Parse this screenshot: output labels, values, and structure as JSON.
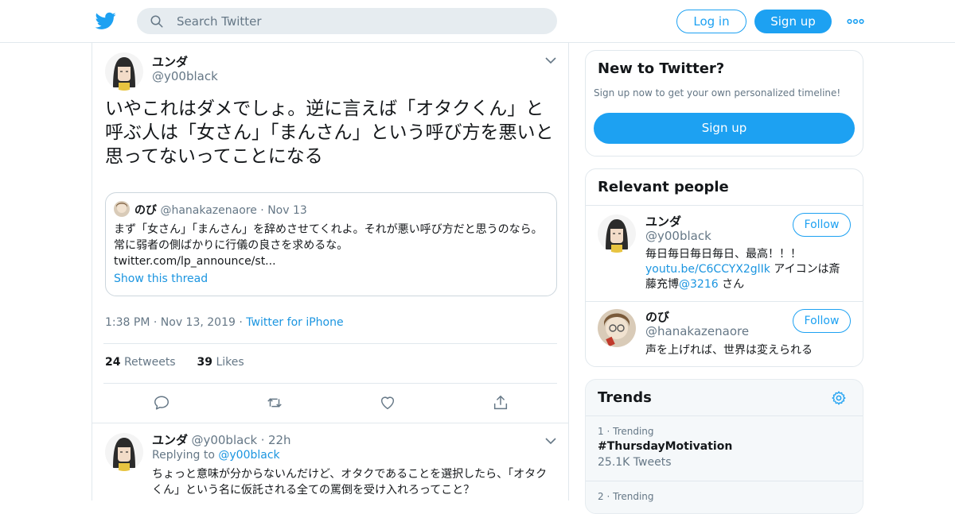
{
  "header": {
    "search_placeholder": "Search Twitter",
    "login_label": "Log in",
    "signup_label": "Sign up"
  },
  "tweet": {
    "display_name": "ユンダ",
    "handle": "@y00black",
    "text": "いやこれはダメでしょ。逆に言えば「オタクくん」と呼ぶ人は「女さん」「まんさん」という呼び方を悪いと思ってないってことになる",
    "quote": {
      "display_name": "のび",
      "handle": "@hanakazenaore",
      "separator": "·",
      "date": "Nov 13",
      "text": "まず「女さん」「まんさん」を辞めさせてくれよ。それが悪い呼び方だと思うのなら。常に弱者の側ばかりに行儀の良さを求めるな。",
      "link": "twitter.com/lp_announce/st...",
      "show_thread": "Show this thread"
    },
    "time": "1:38 PM",
    "date": "Nov 13, 2019",
    "source": "Twitter for iPhone",
    "retweets_count": "24",
    "retweets_label": "Retweets",
    "likes_count": "39",
    "likes_label": "Likes"
  },
  "reply": {
    "display_name": "ユンダ",
    "handle": "@y00black",
    "age": "22h",
    "replying_prefix": "Replying to",
    "replying_to": "@y00black",
    "text": "ちょっと意味が分からないんだけど、オタクであることを選択したら、「オタクくん」という名に仮託される全ての罵倒を受け入れろってこと？"
  },
  "sidebar": {
    "new_to_twitter": {
      "title": "New to Twitter?",
      "subtitle": "Sign up now to get your own personalized timeline!",
      "button": "Sign up"
    },
    "relevant_people": {
      "title": "Relevant people",
      "people": [
        {
          "name": "ユンダ",
          "handle": "@y00black",
          "follow": "Follow",
          "bio_line1": "毎日毎日毎日毎日、最高！！！",
          "bio_link": "youtu.be/C6CCYX2glIk",
          "bio_line2a": " アイコンは斎",
          "bio_line2b": "藤充博",
          "bio_mention": "@3216",
          "bio_line2c": " さん"
        },
        {
          "name": "のび",
          "handle": "@hanakazenaore",
          "follow": "Follow",
          "bio_line1": "声を上げれば、世界は変えられる"
        }
      ]
    },
    "trends": {
      "title": "Trends",
      "items": [
        {
          "rank": "1",
          "sep": "·",
          "label": "Trending",
          "name": "#ThursdayMotivation",
          "count": "25.1K Tweets"
        },
        {
          "rank": "2",
          "sep": "·",
          "label": "Trending",
          "name": "",
          "count": ""
        }
      ]
    }
  },
  "colors": {
    "accent": "#1da1f2",
    "link": "#1b95e0",
    "muted": "#657786",
    "border": "#e1e8ed"
  }
}
